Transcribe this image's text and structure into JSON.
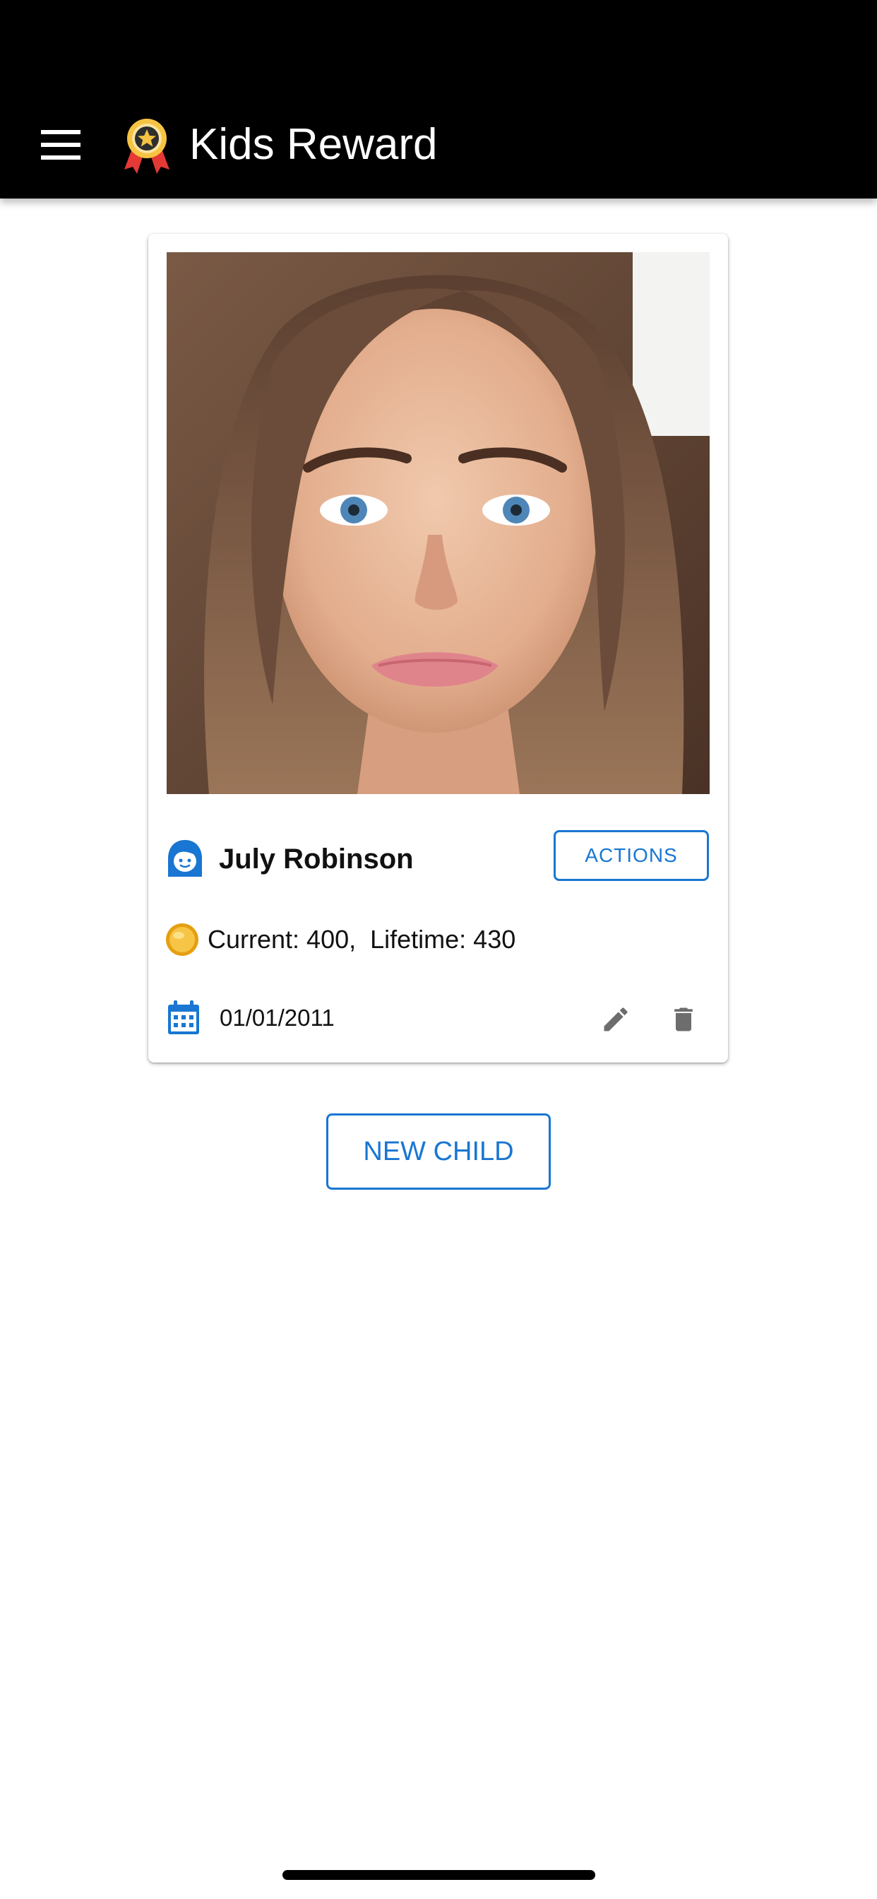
{
  "app_bar": {
    "title": "Kids Reward",
    "menu_icon": "hamburger-menu-icon",
    "logo_icon": "award-ribbon-icon",
    "background": "#000000"
  },
  "child_card": {
    "photo_alt": "Child photo",
    "name": "July Robinson",
    "actions_label": "ACTIONS",
    "points": "Current: 400,  Lifetime: 430",
    "birth_date": "01/01/2011",
    "icons": {
      "child": "girl-face-icon",
      "coin": "gold-coin-icon",
      "calendar": "calendar-icon",
      "edit": "pencil-icon",
      "delete": "trash-icon"
    }
  },
  "new_child_label": "NEW CHILD",
  "colors": {
    "accent": "#1976d2",
    "icon_gray": "#6d6d6d",
    "coin_gold": "#f2b01e"
  }
}
